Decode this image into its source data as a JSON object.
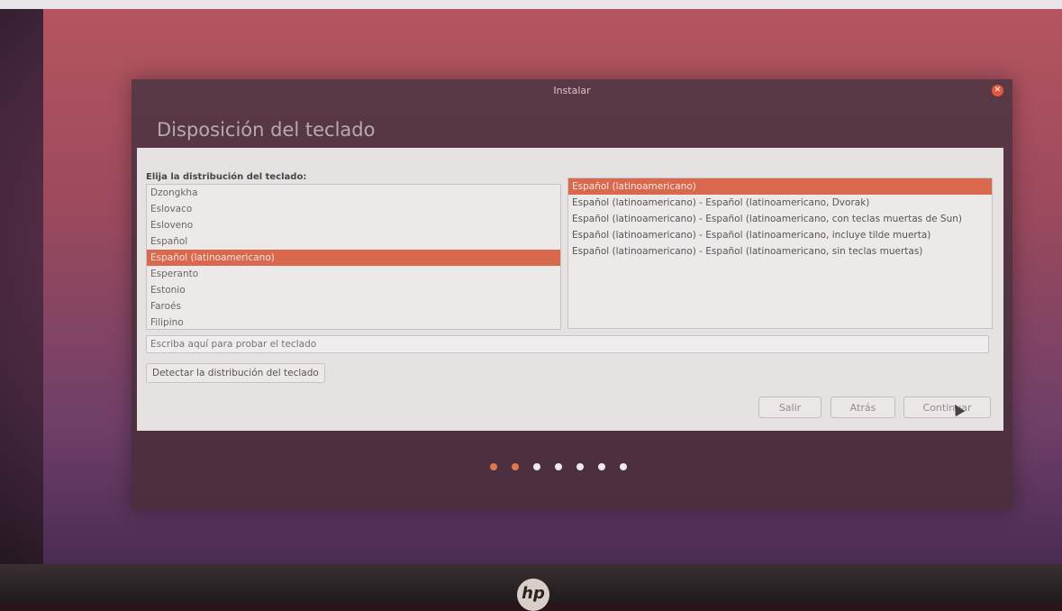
{
  "window": {
    "title": "Instalar",
    "page_title": "Disposición del teclado"
  },
  "layout_prompt": "Elija la distribución del teclado:",
  "languages": [
    {
      "label": "Dzongkha",
      "selected": false
    },
    {
      "label": "Eslovaco",
      "selected": false
    },
    {
      "label": "Esloveno",
      "selected": false
    },
    {
      "label": "Español",
      "selected": false
    },
    {
      "label": "Español (latinoamericano)",
      "selected": true
    },
    {
      "label": "Esperanto",
      "selected": false
    },
    {
      "label": "Estonio",
      "selected": false
    },
    {
      "label": "Faroés",
      "selected": false
    },
    {
      "label": "Filipino",
      "selected": false
    }
  ],
  "variants": [
    {
      "label": "Español (latinoamericano)",
      "selected": true
    },
    {
      "label": "Español (latinoamericano) - Español (latinoamericano, Dvorak)",
      "selected": false
    },
    {
      "label": "Español (latinoamericano) - Español (latinoamericano, con teclas muertas de Sun)",
      "selected": false
    },
    {
      "label": "Español (latinoamericano) - Español (latinoamericano, incluye tilde muerta)",
      "selected": false
    },
    {
      "label": "Español (latinoamericano) - Español (latinoamericano, sin teclas muertas)",
      "selected": false
    }
  ],
  "test_input": {
    "placeholder": "Escriba aquí para probar el teclado",
    "value": ""
  },
  "detect_button": "Detectar la distribución del teclado",
  "nav": {
    "quit": "Salir",
    "back": "Atrás",
    "continue": "Continuar"
  },
  "progress": {
    "total_steps": 7,
    "completed_steps": 2
  },
  "colors": {
    "selection": "#d9694e",
    "progress_done": "#e0784e",
    "progress_todo": "#f0e8ee"
  }
}
